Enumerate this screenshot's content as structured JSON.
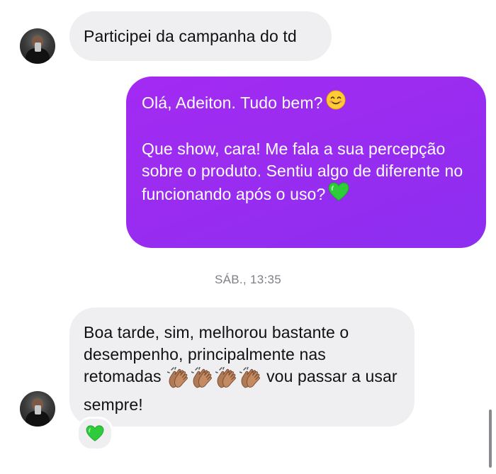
{
  "messages": {
    "incoming_1": {
      "text": "Participei da campanha do td"
    },
    "outgoing_1": {
      "line1": "Olá, Adeiton. Tudo bem?",
      "line1_emoji": "smiling-face-icon",
      "para2": "Que show, cara! Me fala a sua percepção sobre o produto. Sentiu algo de diferente no funcionando após o uso?",
      "para2_emoji": "green-heart-icon"
    },
    "timestamp": "SÁB., 13:35",
    "incoming_2": {
      "text_before": "Boa tarde, sim, melhorou bastante o desempenho, principalmente nas retomadas",
      "clap_emojis": [
        "clapping-hands-icon",
        "clapping-hands-icon",
        "clapping-hands-icon",
        "clapping-hands-icon"
      ],
      "text_after": "vou passar a usar sempre!",
      "reaction": "green-heart-icon"
    }
  },
  "colors": {
    "outgoing_bubble": "#9b2cf0",
    "incoming_bubble": "#efeff1",
    "timestamp_text": "#7f7f86",
    "green_heart": "#2ecc3b"
  }
}
